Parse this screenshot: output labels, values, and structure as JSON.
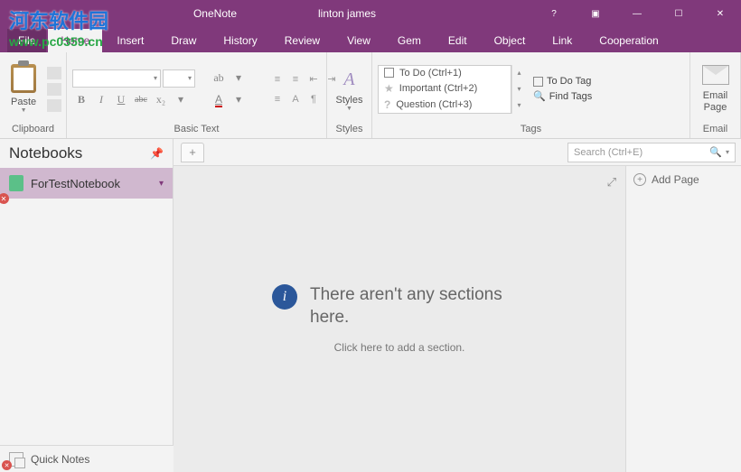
{
  "titlebar": {
    "app": "OneNote",
    "user": "linton james"
  },
  "menu": {
    "file": "File",
    "tabs": [
      "Home",
      "Insert",
      "Draw",
      "History",
      "Review",
      "View",
      "Gem",
      "Edit",
      "Object",
      "Link",
      "Cooperation"
    ],
    "active": "Home"
  },
  "ribbon": {
    "clipboard": {
      "paste": "Paste",
      "label": "Clipboard"
    },
    "basictext": {
      "label": "Basic Text",
      "bold": "B",
      "italic": "I",
      "underline": "U",
      "strike": "abc",
      "sub": "x₂"
    },
    "styles": {
      "btn": "Styles",
      "label": "Styles"
    },
    "tags": {
      "label": "Tags",
      "items": [
        {
          "label": "To Do (Ctrl+1)"
        },
        {
          "label": "Important (Ctrl+2)"
        },
        {
          "label": "Question (Ctrl+3)"
        }
      ],
      "todotag": "To Do Tag",
      "findtags": "Find Tags"
    },
    "email": {
      "btn": "Email\nPage",
      "label": "Email"
    }
  },
  "sidebar": {
    "header": "Notebooks",
    "notebook": "ForTestNotebook",
    "quicknotes": "Quick Notes"
  },
  "search": {
    "placeholder": "Search (Ctrl+E)"
  },
  "canvas": {
    "title": "There aren't any sections here.",
    "sub": "Click here to add a section."
  },
  "pagepanel": {
    "add": "Add Page"
  },
  "watermark": {
    "top": "河东软件园",
    "bottom": "www.pc0359.cn"
  }
}
